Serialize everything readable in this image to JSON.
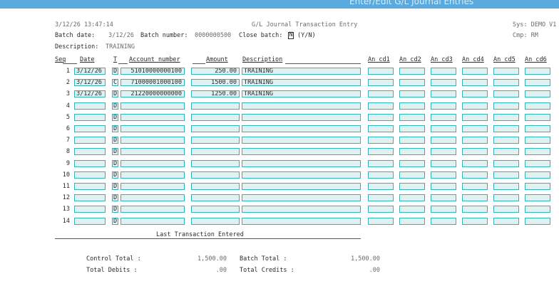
{
  "title_bar": "Enter/Edit G/L Journal Entries",
  "header": {
    "datetime": "3/12/26  13:47:14",
    "screen_title": "G/L Journal Transaction Entry",
    "sys": "Sys: DEMO V1",
    "batch_date_label": "Batch date:",
    "batch_date": "3/12/26",
    "batch_number_label": "Batch number:",
    "batch_number": "0000000500",
    "close_batch_label": "Close batch:",
    "close_batch_value": "N",
    "close_batch_hint": "(Y/N)",
    "cmp": "Cmp: RM",
    "description_label": "Description:",
    "description": "TRAINING"
  },
  "columns": {
    "seq": "Seq",
    "date": "Date",
    "type": "T",
    "account": "Account number",
    "amount": "Amount",
    "description": "Description",
    "an1": "An cd1",
    "an2": "An cd2",
    "an3": "An cd3",
    "an4": "An cd4",
    "an5": "An cd5",
    "an6": "An cd6"
  },
  "rows": [
    {
      "seq": "1",
      "date": "3/12/26",
      "type": "D",
      "account": "51010000000100",
      "amount": "250.00",
      "description": "TRAINING"
    },
    {
      "seq": "2",
      "date": "3/12/26",
      "type": "C",
      "account": "71000001000100",
      "amount": "1500.00",
      "description": "TRAINING"
    },
    {
      "seq": "3",
      "date": "3/12/26",
      "type": "D",
      "account": "21220000000000",
      "amount": "1250.00",
      "description": "TRAINING"
    },
    {
      "seq": "4",
      "date": "",
      "type": "D",
      "account": "",
      "amount": "",
      "description": ""
    },
    {
      "seq": "5",
      "date": "",
      "type": "D",
      "account": "",
      "amount": "",
      "description": ""
    },
    {
      "seq": "6",
      "date": "",
      "type": "D",
      "account": "",
      "amount": "",
      "description": ""
    },
    {
      "seq": "7",
      "date": "",
      "type": "D",
      "account": "",
      "amount": "",
      "description": ""
    },
    {
      "seq": "8",
      "date": "",
      "type": "D",
      "account": "",
      "amount": "",
      "description": ""
    },
    {
      "seq": "9",
      "date": "",
      "type": "D",
      "account": "",
      "amount": "",
      "description": ""
    },
    {
      "seq": "10",
      "date": "",
      "type": "D",
      "account": "",
      "amount": "",
      "description": ""
    },
    {
      "seq": "11",
      "date": "",
      "type": "D",
      "account": "",
      "amount": "",
      "description": ""
    },
    {
      "seq": "12",
      "date": "",
      "type": "D",
      "account": "",
      "amount": "",
      "description": ""
    },
    {
      "seq": "13",
      "date": "",
      "type": "D",
      "account": "",
      "amount": "",
      "description": ""
    },
    {
      "seq": "14",
      "date": "",
      "type": "D",
      "account": "",
      "amount": "",
      "description": ""
    }
  ],
  "last_transaction_label": "Last Transaction Entered",
  "totals": {
    "control_total_label": "Control Total :",
    "control_total": "1,500.00",
    "batch_total_label": "Batch Total   :",
    "batch_total": "1,500.00",
    "total_debits_label": "Total Debits  :",
    "total_debits": ".00",
    "total_credits_label": "Total Credits :",
    "total_credits": ".00"
  },
  "colors": {
    "field_border": "#2fb5b5",
    "field_fill": "#dff1f1",
    "title_bar": "#5aa9df"
  }
}
